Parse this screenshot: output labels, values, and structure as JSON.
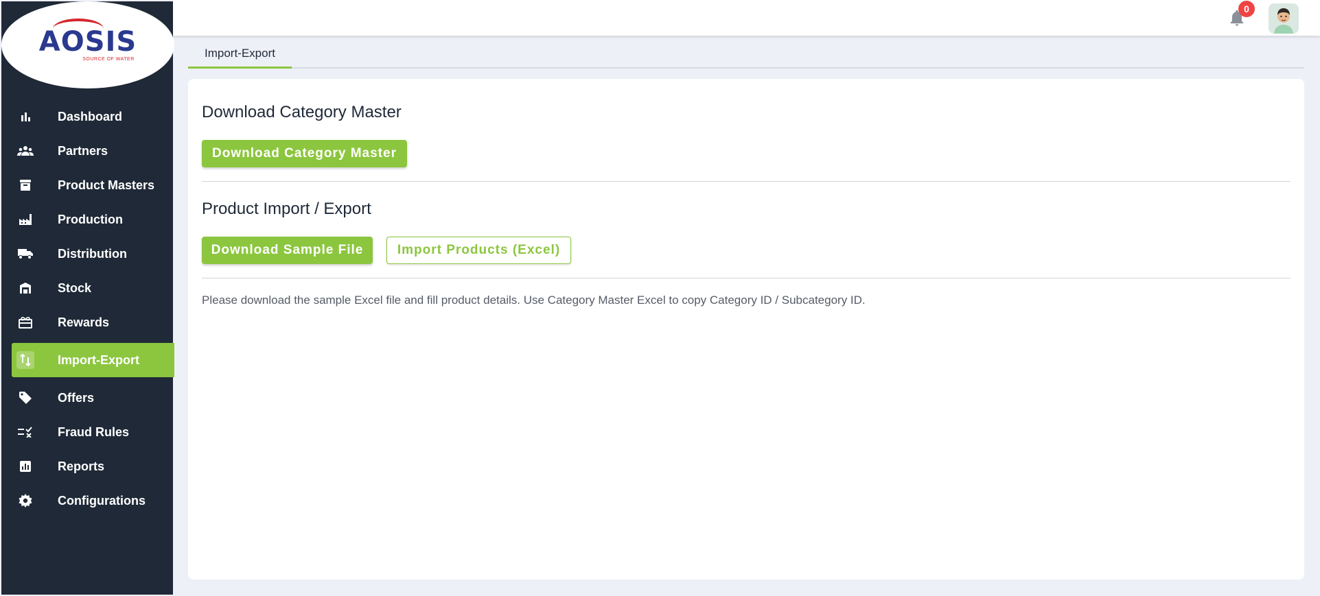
{
  "brand": {
    "logo_main": "AOSIS",
    "logo_sub": "SOURCE OF WATER"
  },
  "sidebar": {
    "items": [
      {
        "label": "Dashboard",
        "icon": "bar-chart-icon"
      },
      {
        "label": "Partners",
        "icon": "people-icon"
      },
      {
        "label": "Product Masters",
        "icon": "archive-box-icon"
      },
      {
        "label": "Production",
        "icon": "factory-icon"
      },
      {
        "label": "Distribution",
        "icon": "truck-icon"
      },
      {
        "label": "Stock",
        "icon": "warehouse-icon"
      },
      {
        "label": "Rewards",
        "icon": "gift-icon"
      },
      {
        "label": "Import-Export",
        "icon": "swap-vertical-icon",
        "active": true
      },
      {
        "label": "Offers",
        "icon": "tag-icon"
      },
      {
        "label": "Fraud Rules",
        "icon": "rule-list-icon"
      },
      {
        "label": "Reports",
        "icon": "report-icon"
      },
      {
        "label": "Configurations",
        "icon": "gear-icon"
      }
    ]
  },
  "header": {
    "notification_count": "0"
  },
  "tabs": [
    {
      "label": "Import-Export",
      "active": true
    }
  ],
  "main": {
    "category_section": {
      "title": "Download Category Master",
      "button_label": "Download Category Master"
    },
    "product_section": {
      "title": "Product Import / Export",
      "download_sample_label": "Download Sample File",
      "import_label": "Import Products (Excel)"
    },
    "help_text": "Please download the sample Excel file and fill product details. Use Category Master Excel to copy Category ID / Subcategory ID."
  },
  "colors": {
    "accent": "#8cc63f",
    "sidebar_bg": "#1f2937",
    "badge": "#ef4444"
  }
}
